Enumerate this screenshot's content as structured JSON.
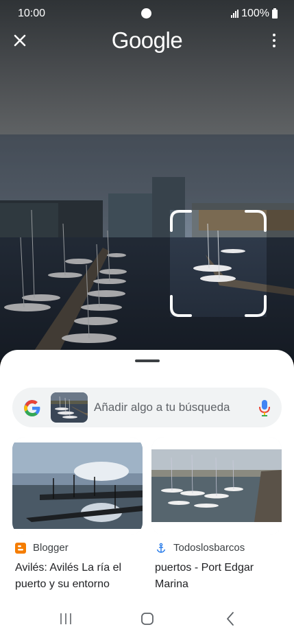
{
  "status_bar": {
    "time": "10:00",
    "battery": "100%"
  },
  "header": {
    "logo_text": "Google",
    "close_icon": "close-icon",
    "menu_icon": "more-vert-icon"
  },
  "search_bar": {
    "placeholder": "Añadir algo a tu búsqueda",
    "g_icon": "google-g-icon",
    "mic_icon": "mic-icon"
  },
  "results": [
    {
      "source": "Blogger",
      "source_icon": "blogger-icon",
      "title": "Avilés: Avilés La ría el puerto y su entorno"
    },
    {
      "source": "Todoslosbarcos",
      "source_icon": "anchor-icon",
      "title": "puertos - Port Edgar Marina"
    }
  ],
  "nav_bar": {
    "recents_icon": "recents-icon",
    "home_icon": "home-icon",
    "back_icon": "back-icon"
  },
  "colors": {
    "google_blue": "#4285F4",
    "google_red": "#EA4335",
    "google_yellow": "#FBBC05",
    "google_green": "#34A853",
    "blogger_orange": "#F57D00"
  }
}
